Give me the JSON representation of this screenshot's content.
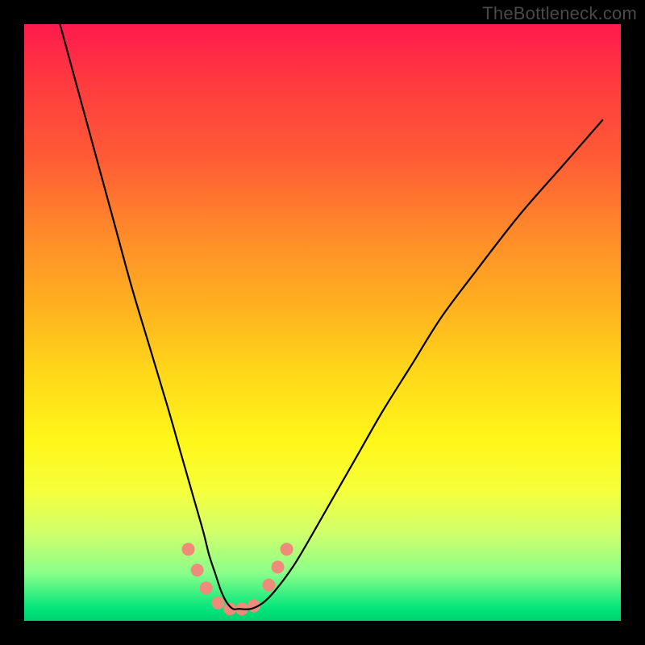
{
  "watermark": "TheBottleneck.com",
  "chart_data": {
    "type": "line",
    "title": "",
    "xlabel": "",
    "ylabel": "",
    "xlim": [
      0,
      100
    ],
    "ylim": [
      0,
      100
    ],
    "grid": false,
    "legend": false,
    "series": [
      {
        "name": "curve",
        "color": "#000000",
        "x": [
          6,
          9,
          12,
          15,
          18,
          21,
          24,
          26,
          28,
          30,
          31,
          32,
          33,
          34,
          35,
          36,
          38,
          40,
          42,
          45,
          48,
          52,
          56,
          60,
          65,
          70,
          76,
          83,
          90,
          97
        ],
        "y": [
          100,
          89,
          78,
          67,
          56,
          46,
          36,
          29,
          22,
          15,
          11,
          8,
          5,
          3,
          2,
          2,
          2,
          3,
          5,
          9,
          14,
          21,
          28,
          35,
          43,
          51,
          59,
          68,
          76,
          84
        ]
      }
    ],
    "markers": [
      {
        "x": 27.5,
        "y": 12,
        "r": 8,
        "color": "#ee8b7a"
      },
      {
        "x": 29.0,
        "y": 8.5,
        "r": 8,
        "color": "#ee8b7a"
      },
      {
        "x": 30.5,
        "y": 5.5,
        "r": 8,
        "color": "#ee8b7a"
      },
      {
        "x": 32.5,
        "y": 3.0,
        "r": 8,
        "color": "#ee8b7a"
      },
      {
        "x": 34.5,
        "y": 2.0,
        "r": 8,
        "color": "#ee8b7a"
      },
      {
        "x": 36.5,
        "y": 2.0,
        "r": 8,
        "color": "#ee8b7a"
      },
      {
        "x": 38.5,
        "y": 2.5,
        "r": 8,
        "color": "#ee8b7a"
      },
      {
        "x": 41.0,
        "y": 6.0,
        "r": 8,
        "color": "#ee8b7a"
      },
      {
        "x": 42.5,
        "y": 9.0,
        "r": 8,
        "color": "#ee8b7a"
      },
      {
        "x": 44.0,
        "y": 12.0,
        "r": 8,
        "color": "#ee8b7a"
      }
    ]
  }
}
